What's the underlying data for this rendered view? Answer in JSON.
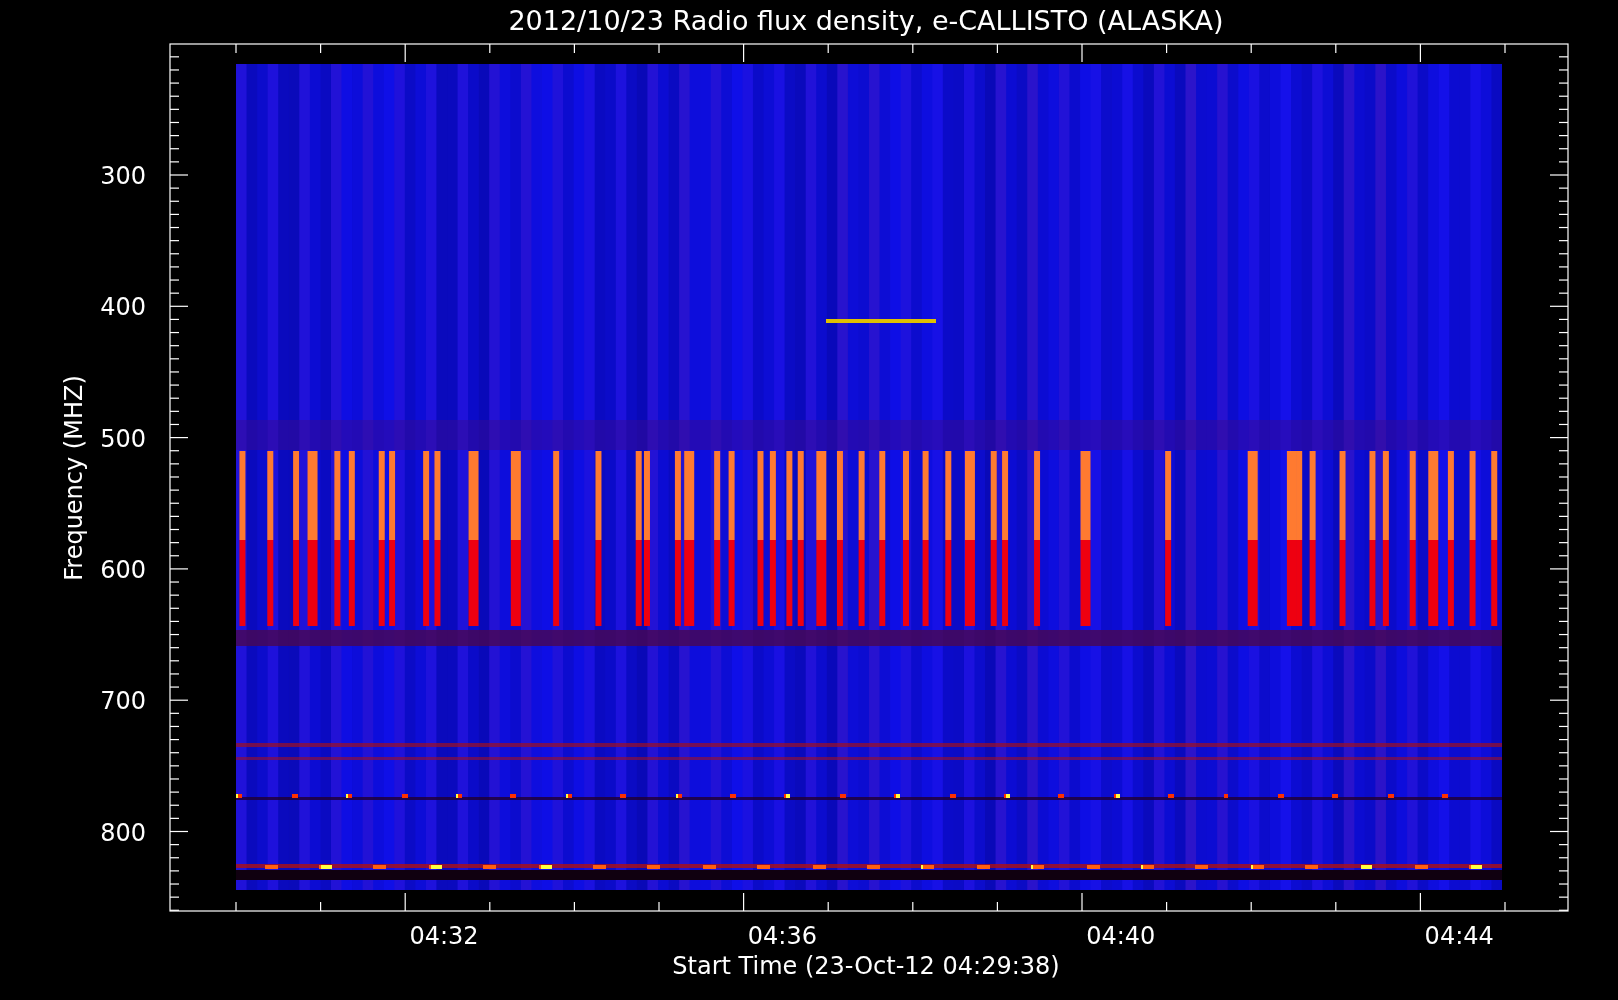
{
  "plot": {
    "title": "2012/10/23  Radio flux density, e-CALLISTO (ALASKA)",
    "xlabel": "Start Time (23-Oct-12 04:29:38)",
    "ylabel": "Frequency (MHZ)",
    "xtick_labels": [
      "04:32",
      "04:36",
      "04:40",
      "04:44"
    ],
    "ytick_labels": [
      "300",
      "400",
      "500",
      "600",
      "700",
      "800"
    ]
  }
}
